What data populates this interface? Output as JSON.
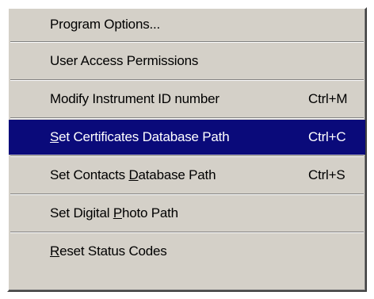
{
  "menu": {
    "items": [
      {
        "label": "Program Options...",
        "shortcut": "",
        "selected": false
      },
      {
        "label": "User Access Permissions",
        "shortcut": "",
        "selected": false
      },
      {
        "label": "Modify Instrument ID number",
        "shortcut": "Ctrl+M",
        "selected": false
      },
      {
        "label_pre": "",
        "label_mn": "S",
        "label_post": "et Certificates Database Path",
        "shortcut": "Ctrl+C",
        "selected": true
      },
      {
        "label_pre": "Set Contacts ",
        "label_mn": "D",
        "label_post": "atabase Path",
        "shortcut": "Ctrl+S",
        "selected": false
      },
      {
        "label_pre": "Set Digital ",
        "label_mn": "P",
        "label_post": "hoto Path",
        "shortcut": "",
        "selected": false
      },
      {
        "label_pre": "",
        "label_mn": "R",
        "label_post": "eset Status Codes",
        "shortcut": "",
        "selected": false
      }
    ],
    "colors": {
      "menu_bg": "#d4d0c8",
      "highlight_bg": "#0a0a7a",
      "highlight_text": "#ffffff"
    }
  }
}
